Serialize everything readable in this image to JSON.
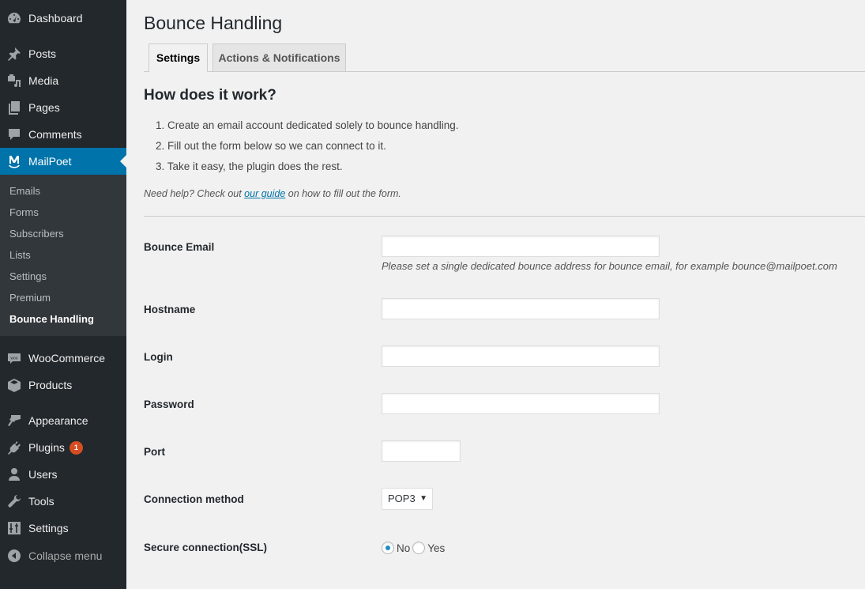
{
  "sidebar": {
    "items": [
      {
        "label": "Dashboard",
        "icon": "dashboard-icon"
      },
      {
        "label": "Posts",
        "icon": "pushpin-icon"
      },
      {
        "label": "Media",
        "icon": "media-icon"
      },
      {
        "label": "Pages",
        "icon": "pages-icon"
      },
      {
        "label": "Comments",
        "icon": "comment-icon"
      },
      {
        "label": "MailPoet",
        "icon": "mailpoet-icon",
        "current": true
      },
      {
        "label": "WooCommerce",
        "icon": "woocommerce-icon"
      },
      {
        "label": "Products",
        "icon": "box-icon"
      },
      {
        "label": "Appearance",
        "icon": "paintbrush-icon"
      },
      {
        "label": "Plugins",
        "icon": "plug-icon",
        "badge": "1"
      },
      {
        "label": "Users",
        "icon": "user-icon"
      },
      {
        "label": "Tools",
        "icon": "wrench-icon"
      },
      {
        "label": "Settings",
        "icon": "sliders-icon"
      },
      {
        "label": "Collapse menu",
        "icon": "collapse-arrow-icon"
      }
    ],
    "submenu": [
      {
        "label": "Emails"
      },
      {
        "label": "Forms"
      },
      {
        "label": "Subscribers"
      },
      {
        "label": "Lists"
      },
      {
        "label": "Settings"
      },
      {
        "label": "Premium"
      },
      {
        "label": "Bounce Handling",
        "current": true
      }
    ]
  },
  "page": {
    "title": "Bounce Handling",
    "tabs": [
      {
        "label": "Settings",
        "active": true
      },
      {
        "label": "Actions & Notifications",
        "active": false
      }
    ],
    "section_title": "How does it work?",
    "steps": [
      "1. Create an email account dedicated solely to bounce handling.",
      "2. Fill out the form below so we can connect to it.",
      "3. Take it easy, the plugin does the rest."
    ],
    "help": {
      "prefix": "Need help? Check out ",
      "link": "our guide",
      "suffix": " on how to fill out the form."
    }
  },
  "form": {
    "bounce_email": {
      "label": "Bounce Email",
      "value": "",
      "description": "Please set a single dedicated bounce address for bounce email, for example bounce@mailpoet.com"
    },
    "hostname": {
      "label": "Hostname",
      "value": ""
    },
    "login": {
      "label": "Login",
      "value": ""
    },
    "password": {
      "label": "Password",
      "value": ""
    },
    "port": {
      "label": "Port",
      "value": ""
    },
    "connection_method": {
      "label": "Connection method",
      "selected": "POP3"
    },
    "ssl": {
      "label": "Secure connection(SSL)",
      "options": [
        "No",
        "Yes"
      ],
      "selected": "No"
    }
  },
  "colors": {
    "sidebar_bg": "#23282d",
    "submenu_bg": "#32373c",
    "accent": "#0073aa",
    "badge": "#d54e21",
    "page_bg": "#f1f1f1"
  }
}
